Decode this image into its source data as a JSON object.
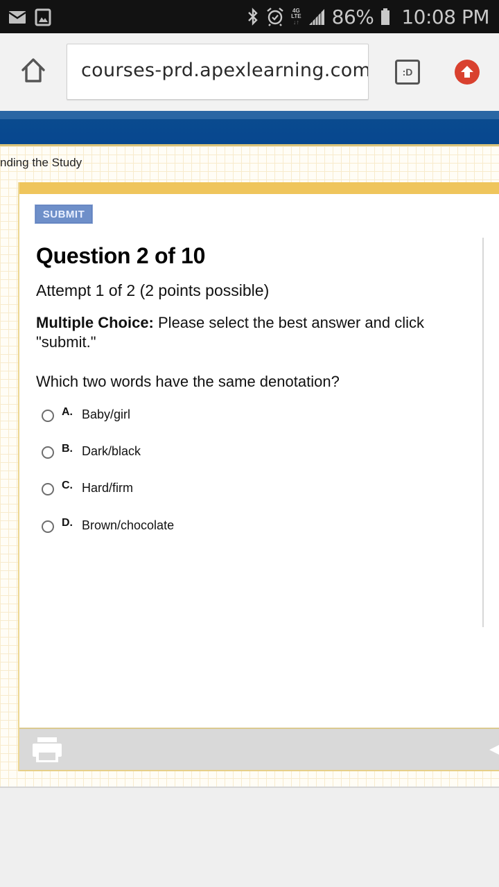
{
  "status_bar": {
    "left_icons": [
      "mail-icon",
      "gallery-icon"
    ],
    "right_icons": [
      "bluetooth-icon",
      "alarm-icon",
      "4g-lte-icon",
      "signal-icon",
      "battery-icon"
    ],
    "network_label_top": "4G",
    "network_label_bottom": "LTE",
    "network_arrows": "↓↑",
    "battery_percent": "86%",
    "time": "10:08 PM"
  },
  "browser": {
    "url": "courses-prd.apexlearning.com/",
    "tab_switcher_label": ":D",
    "home_icon": "home-icon",
    "extension_icon": "upload-arrow-icon",
    "colors": {
      "extension": "#d9412f"
    }
  },
  "page": {
    "breadcrumb": "nding the Study",
    "submit_label": "SUBMIT",
    "question_title": "Question 2 of 10",
    "attempt": "Attempt 1 of 2 (2 points possible)",
    "instructions_bold": "Multiple Choice:",
    "instructions_text": " Please select the best answer and click \"submit.\"",
    "prompt": "Which two words have the same denotation?",
    "options": [
      {
        "letter": "A.",
        "text": "Baby/girl",
        "selected": false
      },
      {
        "letter": "B.",
        "text": "Dark/black",
        "selected": false
      },
      {
        "letter": "C.",
        "text": "Hard/firm",
        "selected": false
      },
      {
        "letter": "D.",
        "text": "Brown/chocolate",
        "selected": false
      }
    ],
    "footer_icons": [
      "print-icon",
      "back-arrow-icon"
    ],
    "colors": {
      "header_blue": "#07478f",
      "card_accent": "#efc55c",
      "submit_button": "#6e8fc9"
    }
  }
}
